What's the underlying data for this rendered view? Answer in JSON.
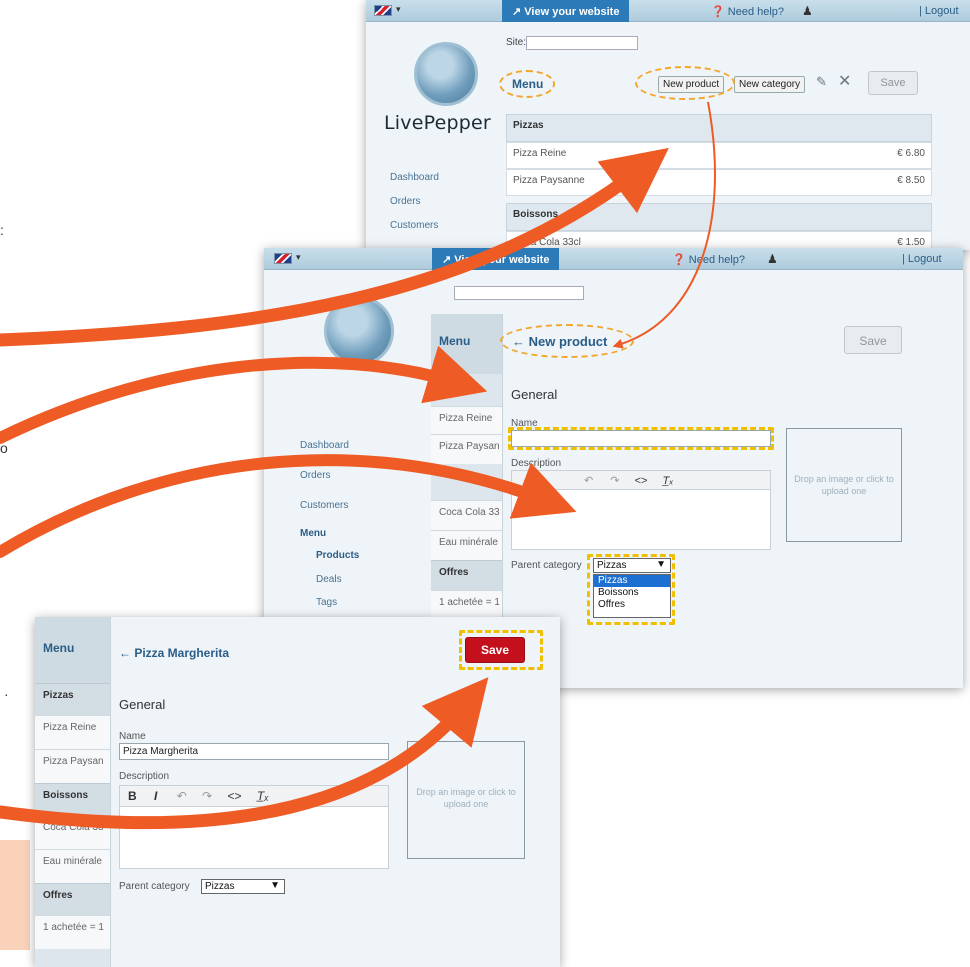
{
  "topbar": {
    "view_site_label": "View your website",
    "help_label": "Need help?",
    "logout_label": "| Logout"
  },
  "brand": {
    "name": "LivePepper"
  },
  "nav": {
    "dashboard": "Dashboard",
    "orders": "Orders",
    "customers": "Customers",
    "menu": "Menu",
    "products": "Products",
    "deals": "Deals",
    "tags": "Tags"
  },
  "screen1": {
    "site_label": "Site:",
    "menu_title": "Menu",
    "new_product_button": "New product",
    "new_category_button": "New category",
    "save_button": "Save",
    "categories": [
      {
        "name": "Pizzas",
        "products": [
          {
            "name": "Pizza Reine",
            "price": "€ 6.80"
          },
          {
            "name": "Pizza Paysanne",
            "price": "€ 8.50"
          }
        ]
      },
      {
        "name": "Boissons",
        "products": [
          {
            "name": "Coca Cola 33cl",
            "price": "€ 1.50"
          }
        ]
      }
    ]
  },
  "screen2": {
    "menu_title": "Menu",
    "form_title": "← New product",
    "save_button": "Save",
    "section_general": "General",
    "name_label": "Name",
    "name_value": "",
    "description_label": "Description",
    "toolbar": {
      "undo": "↶",
      "redo": "↷",
      "code": "<>",
      "clear": "T̲ₓ"
    },
    "dropzone_text": "Drop an image or click to upload one",
    "parent_category_label": "Parent category",
    "parent_category_value": "Pizzas",
    "parent_category_options": [
      "Pizzas",
      "Boissons",
      "Offres"
    ],
    "side_items": {
      "pizza_reine": "Pizza Reine",
      "pizza_paysanne": "Pizza Paysan",
      "coca": "Coca Cola 33",
      "eau": "Eau minérale",
      "offres": "Offres",
      "offer_item": "1 achetée = 1"
    }
  },
  "screen3": {
    "menu_title": "Menu",
    "form_title": "← Pizza Margherita",
    "save_button": "Save",
    "section_general": "General",
    "name_label": "Name",
    "name_value": "Pizza Margherita",
    "description_label": "Description",
    "toolbar": {
      "bold": "B",
      "italic": "I",
      "undo": "↶",
      "redo": "↷",
      "code": "<>",
      "clear": "T̲ₓ"
    },
    "dropzone_text": "Drop an image or click to upload one",
    "parent_category_label": "Parent category",
    "parent_category_value": "Pizzas",
    "side_items": {
      "pizzas": "Pizzas",
      "pizza_reine": "Pizza Reine",
      "pizza_paysanne": "Pizza Paysan",
      "boissons": "Boissons",
      "coca": "Coca Cola 33",
      "eau": "Eau minérale",
      "offres": "Offres",
      "offer_item": "1 achetée = 1"
    }
  },
  "colors": {
    "accent_blue": "#2a5d87",
    "save_red": "#c4101c",
    "arrow_orange": "#ee5b24",
    "highlight_yellow": "#f0c000"
  }
}
